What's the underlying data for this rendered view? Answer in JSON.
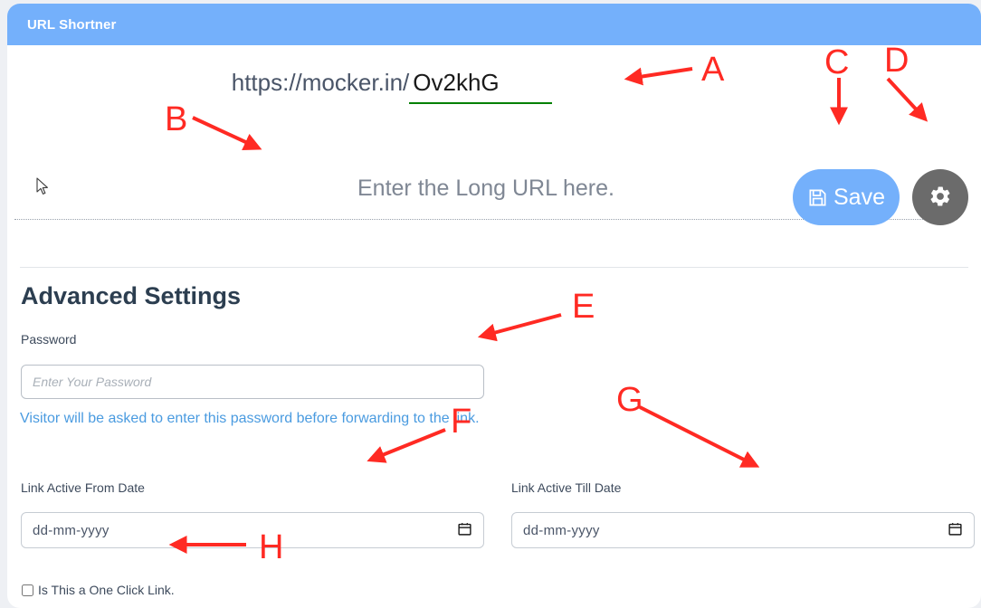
{
  "window": {
    "title": "URL Shortner"
  },
  "short_url": {
    "domain_prefix": "https://mocker.in/",
    "code_value": "Ov2khG",
    "underline_color": "#008000"
  },
  "long_url": {
    "placeholder": "Enter the Long URL here.",
    "value": ""
  },
  "actions": {
    "save_label": "Save",
    "save_icon": "floppy-disk-icon",
    "settings_icon": "gear-icon",
    "save_color": "#74b0fb",
    "settings_color": "#6b6b6b"
  },
  "advanced": {
    "title": "Advanced Settings",
    "password": {
      "label": "Password",
      "placeholder": "Enter Your Password",
      "value": "",
      "help_text": "Visitor will be asked to enter this password before forwarding to the link.",
      "help_color": "#4a9be0"
    },
    "from_date": {
      "label": "Link Active From Date",
      "placeholder": "dd-mm-yyyy",
      "value": ""
    },
    "till_date": {
      "label": "Link Active Till Date",
      "placeholder": "dd-mm-yyyy",
      "value": ""
    },
    "one_click": {
      "label": "Is This a One Click Link.",
      "checked": false
    }
  },
  "annotations": {
    "color": "#ff2a23",
    "items": [
      {
        "letter": "A",
        "target": "short-url-code-input"
      },
      {
        "letter": "B",
        "target": "long-url-input"
      },
      {
        "letter": "C",
        "target": "save-button"
      },
      {
        "letter": "D",
        "target": "settings-button"
      },
      {
        "letter": "E",
        "target": "password-input"
      },
      {
        "letter": "F",
        "target": "from-date-input"
      },
      {
        "letter": "G",
        "target": "till-date-input"
      },
      {
        "letter": "H",
        "target": "one-click-checkbox"
      }
    ]
  }
}
